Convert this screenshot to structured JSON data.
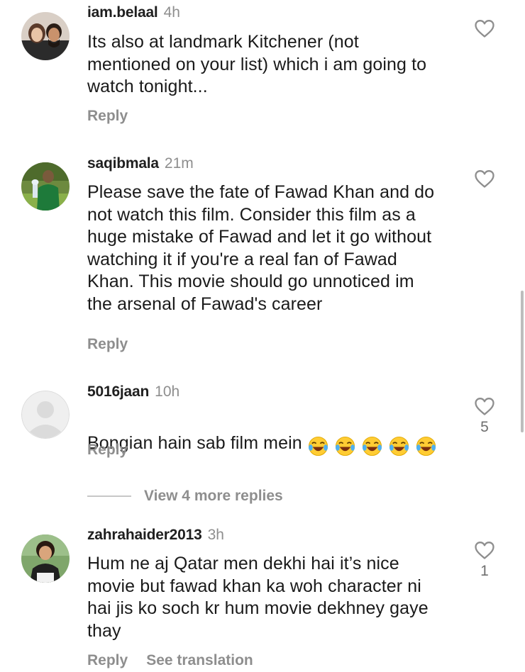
{
  "comments": [
    {
      "username": "iam.belaal",
      "time": "4h",
      "text": "Its also at landmark Kitchener (not\nmentioned on your list) which i am going to\nwatch tonight...",
      "reply_label": "Reply",
      "likes": ""
    },
    {
      "username": "saqibmala",
      "time": "21m",
      "text": "Please save the fate of Fawad Khan and do\nnot watch this film. Consider this film as a\nhuge mistake of Fawad and let it go without\nwatching it if you're a real fan of Fawad\nKhan. This movie should go unnoticed im\nthe arsenal of Fawad's career",
      "reply_label": "Reply",
      "likes": ""
    },
    {
      "username": "5016jaan",
      "time": "10h",
      "text": "Bongian hain sab film mein",
      "emoji": "😂😂😂😂😂",
      "reply_label": "Reply",
      "likes": "5"
    },
    {
      "username": "zahrahaider2013",
      "time": "3h",
      "text": "Hum ne aj Qatar men dekhi hai it’s nice\nmovie but fawad khan ka woh character ni\nhai jis ko soch kr hum movie dekhney gaye\nthay",
      "reply_label": "Reply",
      "see_translation_label": "See translation",
      "likes": "1"
    }
  ],
  "view_more_replies": "View 4 more replies",
  "icons": {
    "like": "heart-outline-icon",
    "emoji": "face-with-tears-of-joy"
  },
  "colors": {
    "secondary_text": "#8e8e8e",
    "primary_text": "#1a1a1a",
    "background": "#ffffff"
  }
}
